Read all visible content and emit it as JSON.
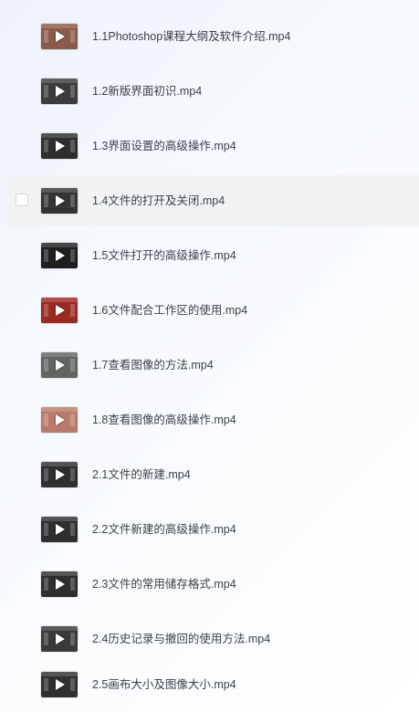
{
  "files": [
    {
      "name": "1.1Photoshop课程大纲及软件介绍.mp4",
      "thumb_color": "#8a5a4a",
      "hovered": false
    },
    {
      "name": "1.2新版界面初识.mp4",
      "thumb_color": "#3c3c3c",
      "hovered": false
    },
    {
      "name": "1.3界面设置的高级操作.mp4",
      "thumb_color": "#2e2e2e",
      "hovered": false
    },
    {
      "name": "1.4文件的打开及关闭.mp4",
      "thumb_color": "#353535",
      "hovered": true
    },
    {
      "name": "1.5文件打开的高级操作.mp4",
      "thumb_color": "#1f1f1f",
      "hovered": false
    },
    {
      "name": "1.6文件配合工作区的使用.mp4",
      "thumb_color": "#9a2a22",
      "hovered": false
    },
    {
      "name": "1.7查看图像的方法.mp4",
      "thumb_color": "#5e6660",
      "hovered": false
    },
    {
      "name": "1.8查看图像的高级操作.mp4",
      "thumb_color": "#b87a6a",
      "hovered": false
    },
    {
      "name": "2.1文件的新建.mp4",
      "thumb_color": "#2f2f2f",
      "hovered": false
    },
    {
      "name": "2.2文件新建的高级操作.mp4",
      "thumb_color": "#2f2f2f",
      "hovered": false
    },
    {
      "name": "2.3文件的常用储存格式.mp4",
      "thumb_color": "#2f2f2f",
      "hovered": false
    },
    {
      "name": "2.4历史记录与撤回的使用方法.mp4",
      "thumb_color": "#3a3a3a",
      "hovered": false
    },
    {
      "name": "2.5画布大小及图像大小.mp4",
      "thumb_color": "#303030",
      "hovered": false
    }
  ]
}
